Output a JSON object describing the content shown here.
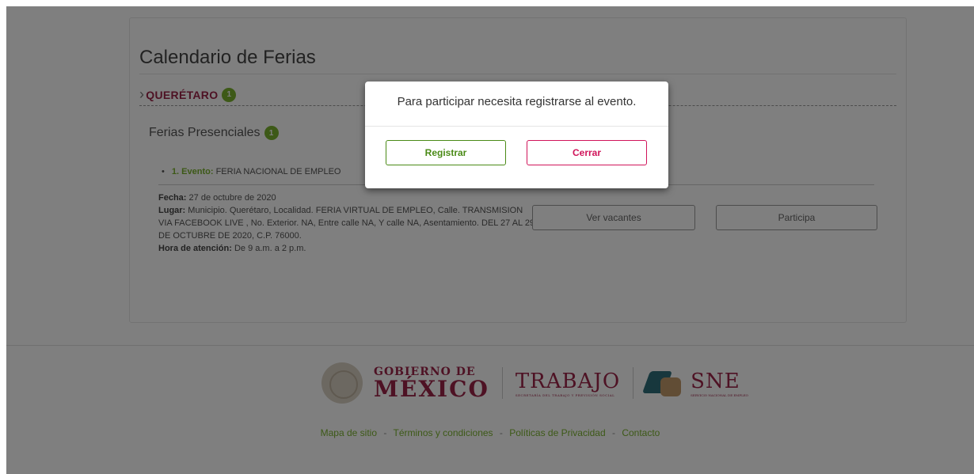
{
  "page": {
    "title": "Calendario de Ferias",
    "state": {
      "name": "QUERÉTARO",
      "count": "1"
    },
    "section": {
      "title": "Ferias Presenciales",
      "count": "1"
    },
    "event": {
      "label": "1. Evento:",
      "name": "FERIA NACIONAL DE EMPLEO",
      "fecha_label": "Fecha:",
      "fecha": "27 de octubre de 2020",
      "lugar_label": "Lugar:",
      "lugar": "Municipio. Querétaro, Localidad. FERIA VIRTUAL DE EMPLEO, Calle. TRANSMISION VIA FACEBOOK LIVE , No. Exterior. NA, Entre calle NA, Y calle NA, Asentamiento. DEL 27 AL 29 DE OCTUBRE DE 2020, C.P. 76000.",
      "hora_label": "Hora de atención:",
      "hora": "De 9 a.m. a 2 p.m.",
      "vacantes_button": "Ver vacantes",
      "participa_button": "Participa"
    }
  },
  "footer": {
    "gob_line1": "GOBIERNO DE",
    "gob_line2": "MÉXICO",
    "trabajo": "TRABAJO",
    "trabajo_sub": "SECRETARÍA DEL TRABAJO Y PREVISIÓN SOCIAL",
    "sne": "SNE",
    "sne_sub": "SERVICIO NACIONAL DE EMPLEO",
    "links": [
      "Mapa de sitio",
      "Términos y condiciones",
      "Políticas de Privacidad",
      "Contacto"
    ],
    "separator": "-"
  },
  "modal": {
    "message": "Para participar necesita registrarse al evento.",
    "register_button": "Registrar",
    "close_button": "Cerrar"
  },
  "colors": {
    "accent_green": "#7ab32e",
    "accent_wine": "#9d2449",
    "close_pink": "#d0145a",
    "overlay": "rgba(0,0,0,0.5)"
  }
}
